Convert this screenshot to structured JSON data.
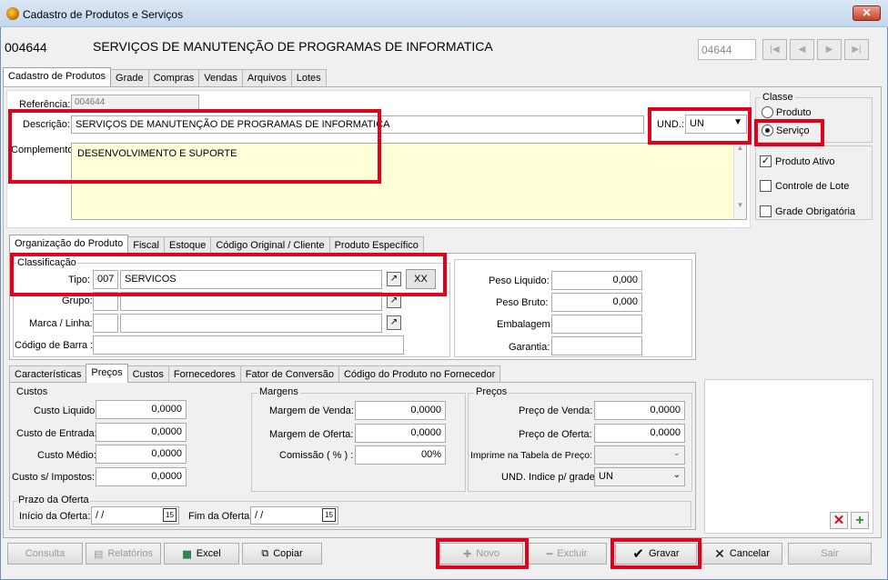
{
  "window": {
    "title": "Cadastro de Produtos e Serviços",
    "close": "✕"
  },
  "header": {
    "code": "004644",
    "name": "SERVIÇOS DE MANUTENÇÃO DE PROGRAMAS DE INFORMATICA",
    "nav_value": "04644"
  },
  "main_tabs": [
    "Cadastro de Produtos",
    "Grade",
    "Compras",
    "Vendas",
    "Arquivos",
    "Lotes"
  ],
  "form": {
    "referencia_label": "Referência:",
    "referencia_value": "004644",
    "descricao_label": "Descrição:",
    "descricao_value": "SERVIÇOS DE MANUTENÇÃO DE PROGRAMAS DE INFORMATICA",
    "und_label": "UND.:",
    "und_value": "UN",
    "complemento_label": "Complemento:",
    "complemento_value": "DESENVOLVIMENTO E SUPORTE"
  },
  "classe": {
    "title": "Classe",
    "produto": "Produto",
    "servico": "Serviço"
  },
  "checks": {
    "ativo": "Produto Ativo",
    "lote": "Controle de Lote",
    "grade": "Grade Obrigatória"
  },
  "org_tabs": [
    "Organização do Produto",
    "Fiscal",
    "Estoque",
    "Código Original / Cliente",
    "Produto Específico"
  ],
  "classificacao": {
    "title": "Classificação",
    "tipo_label": "Tipo:",
    "tipo_code": "007",
    "tipo_name": "SERVICOS",
    "xx": "XX",
    "grupo_label": "Grupo:",
    "marca_label": "Marca / Linha:",
    "barra_label": "Código de Barra :"
  },
  "pesos": {
    "liquido_label": "Peso Liquido:",
    "liquido_value": "0,000",
    "bruto_label": "Peso Bruto:",
    "bruto_value": "0,000",
    "embalagem_label": "Embalagem:",
    "garantia_label": "Garantia:"
  },
  "price_tabs": [
    "Características",
    "Preços",
    "Custos",
    "Fornecedores",
    "Fator de Conversão",
    "Código do Produto no Fornecedor"
  ],
  "custos": {
    "title": "Custos",
    "liquido_label": "Custo Liquido:",
    "liquido": "0,0000",
    "entrada_label": "Custo de Entrada:",
    "entrada": "0,0000",
    "medio_label": "Custo Médio:",
    "medio": "0,0000",
    "impostos_label": "Custo s/ Impostos:",
    "impostos": "0,0000"
  },
  "margens": {
    "title": "Margens",
    "venda_label": "Margem de Venda:",
    "venda": "0,0000",
    "oferta_label": "Margem de Oferta:",
    "oferta": "0,0000",
    "comissao_label": "Comissão ( % ) :",
    "comissao": "00%"
  },
  "precos": {
    "title": "Preços",
    "venda_label": "Preço de Venda:",
    "venda": "0,0000",
    "oferta_label": "Preço de Oferta:",
    "oferta": "0,0000",
    "tabela_label": "Imprime na Tabela de Preço:",
    "indice_label": "UND. Indice p/ grade:",
    "indice": "UN"
  },
  "prazo": {
    "title": "Prazo da Oferta",
    "inicio_label": "Início da Oferta:",
    "inicio": " / /",
    "fim_label": "Fim da Oferta:",
    "fim": " / /",
    "cal": "15"
  },
  "buttons": {
    "consulta": "Consulta",
    "relatorios": "Relatórios",
    "excel": "Excel",
    "copiar": "Copiar",
    "novo": "Novo",
    "excluir": "Excluir",
    "gravar": "Gravar",
    "cancelar": "Cancelar",
    "sair": "Sair"
  }
}
